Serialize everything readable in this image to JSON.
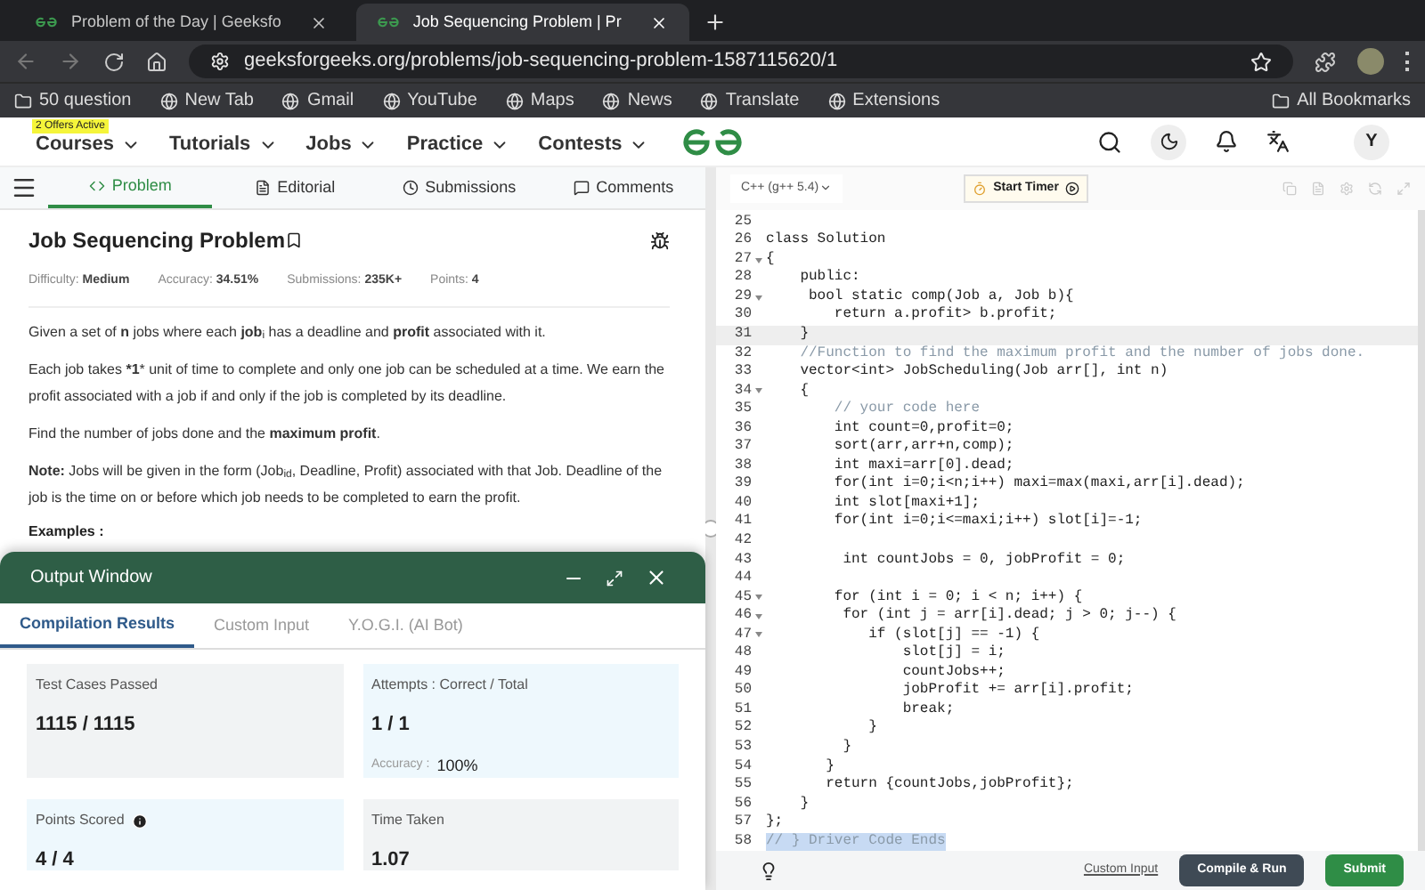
{
  "browser": {
    "tabs": [
      {
        "title": "Problem of the Day | Geeksfo",
        "selected": false
      },
      {
        "title": "Job Sequencing Problem | Pr",
        "selected": true
      }
    ],
    "url": "geeksforgeeks.org/problems/job-sequencing-problem-1587115620/1",
    "bookmarks": [
      "50 question",
      "New Tab",
      "Gmail",
      "YouTube",
      "Maps",
      "News",
      "Translate",
      "Extensions"
    ],
    "all_bookmarks": "All Bookmarks"
  },
  "site_nav": {
    "badge": "2 Offers Active",
    "items": [
      "Courses",
      "Tutorials",
      "Jobs",
      "Practice",
      "Contests"
    ],
    "avatar": "Y"
  },
  "problem_tabs": [
    {
      "label": "Problem",
      "selected": true
    },
    {
      "label": "Editorial",
      "selected": false
    },
    {
      "label": "Submissions",
      "selected": false
    },
    {
      "label": "Comments",
      "selected": false
    }
  ],
  "problem": {
    "title": "Job Sequencing Problem",
    "stats": [
      {
        "label": "Difficulty:",
        "value": "Medium"
      },
      {
        "label": "Accuracy:",
        "value": "34.51%"
      },
      {
        "label": "Submissions:",
        "value": "235K+"
      },
      {
        "label": "Points:",
        "value": "4"
      }
    ],
    "paragraphs": [
      "Given a set of **n** jobs where each **job**$_{i}$ has a deadline and **profit** associated with it.",
      "Each job takes ***1*** unit of time to complete and only one job can be scheduled at a time. We earn the profit associated with a job if and only if the job is completed by its deadline.",
      "Find the number of jobs done and the **maximum profit**.",
      "**Note:** Jobs will be given in the form (Job$_{id}$, Deadline, Profit) associated with that Job. Deadline of the job is the time on or before which job needs to be completed to earn the profit."
    ],
    "examples_heading": "Examples :"
  },
  "output_window": {
    "title": "Output Window",
    "tabs": [
      {
        "label": "Compilation Results",
        "selected": true
      },
      {
        "label": "Custom Input",
        "selected": false
      },
      {
        "label": "Y.O.G.I. (AI Bot)",
        "selected": false
      }
    ],
    "cards": [
      {
        "label": "Test Cases Passed",
        "value": "1115 / 1115",
        "color": "#f1f3f4",
        "info": false
      },
      {
        "label": "Attempts : Correct / Total",
        "value": "1 / 1",
        "color": "#eef8fd",
        "info": false,
        "sub_label": "Accuracy :",
        "sub_value": "100%"
      },
      {
        "label": "Points Scored",
        "value": "4 / 4",
        "color": "#eef8fd",
        "info": true
      },
      {
        "label": "Time Taken",
        "value": "1.07",
        "color": "#f1f3f4",
        "info": false
      }
    ]
  },
  "editor": {
    "language": "C++ (g++ 5.4)",
    "timer_button": "Start Timer",
    "lines": [
      {
        "num": "25"
      },
      {
        "num": "26",
        "text": "class Solution",
        "kind": "code"
      },
      {
        "num": "27",
        "text": "{",
        "kind": "code",
        "foldable": true
      },
      {
        "num": "28",
        "text": "    public:",
        "kind": "code"
      },
      {
        "num": "29",
        "text": "     bool static comp(Job a, Job b){",
        "kind": "code",
        "foldable": true
      },
      {
        "num": "30",
        "text": "        return a.profit> b.profit;",
        "kind": "code"
      },
      {
        "num": "31",
        "text": "    }",
        "kind": "code",
        "current": true
      },
      {
        "num": "32",
        "text": "    //Function to find the maximum profit and the number of jobs done.",
        "kind": "comment"
      },
      {
        "num": "33",
        "text": "    vector<int> JobScheduling(Job arr[], int n)",
        "kind": "code"
      },
      {
        "num": "34",
        "text": "    {",
        "kind": "code",
        "foldable": true
      },
      {
        "num": "35",
        "text": "        // your code here",
        "kind": "comment"
      },
      {
        "num": "36",
        "text": "        int count=0,profit=0;",
        "kind": "code"
      },
      {
        "num": "37",
        "text": "        sort(arr,arr+n,comp);",
        "kind": "code"
      },
      {
        "num": "38",
        "text": "        int maxi=arr[0].dead;",
        "kind": "code"
      },
      {
        "num": "39",
        "text": "        for(int i=0;i<n;i++) maxi=max(maxi,arr[i].dead);",
        "kind": "code"
      },
      {
        "num": "40",
        "text": "        int slot[maxi+1];",
        "kind": "code"
      },
      {
        "num": "41",
        "text": "        for(int i=0;i<=maxi;i++) slot[i]=-1;",
        "kind": "code"
      },
      {
        "num": "42"
      },
      {
        "num": "43",
        "text": "         int countJobs = 0, jobProfit = 0;",
        "kind": "code"
      },
      {
        "num": "44"
      },
      {
        "num": "45",
        "text": "        for (int i = 0; i < n; i++) {",
        "kind": "code",
        "foldable": true
      },
      {
        "num": "46",
        "text": "         for (int j = arr[i].dead; j > 0; j--) {",
        "kind": "code",
        "foldable": true
      },
      {
        "num": "47",
        "text": "            if (slot[j] == -1) {",
        "kind": "code",
        "foldable": true
      },
      {
        "num": "48",
        "text": "                slot[j] = i;",
        "kind": "code"
      },
      {
        "num": "49",
        "text": "                countJobs++;",
        "kind": "code"
      },
      {
        "num": "50",
        "text": "                jobProfit += arr[i].profit;",
        "kind": "code"
      },
      {
        "num": "51",
        "text": "                break;",
        "kind": "code"
      },
      {
        "num": "52",
        "text": "            }",
        "kind": "code"
      },
      {
        "num": "53",
        "text": "         }",
        "kind": "code"
      },
      {
        "num": "54",
        "text": "       }",
        "kind": "code"
      },
      {
        "num": "55",
        "text": "       return {countJobs,jobProfit};",
        "kind": "code"
      },
      {
        "num": "56",
        "text": "    }",
        "kind": "code"
      },
      {
        "num": "57",
        "text": "};",
        "kind": "code"
      },
      {
        "num": "58",
        "text": "// } Driver Code Ends",
        "kind": "comment",
        "selected": true
      }
    ],
    "custom_input_link": "Custom Input",
    "compile_button": "Compile & Run",
    "submit_button": "Submit"
  }
}
